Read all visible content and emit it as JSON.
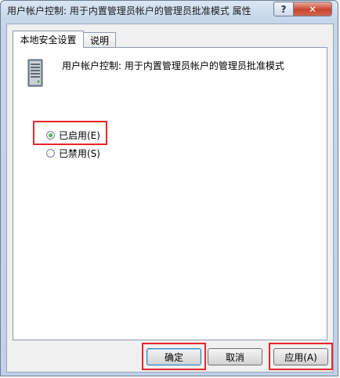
{
  "window": {
    "title": "用户帐户控制: 用于内置管理员帐户的管理员批准模式 属性",
    "help_glyph": "?",
    "close_glyph": "✕"
  },
  "tabs": [
    {
      "label": "本地安全设置",
      "active": true
    },
    {
      "label": "说明",
      "active": false
    }
  ],
  "policy": {
    "icon": "server-icon",
    "name": "用户帐户控制: 用于内置管理员帐户的管理员批准模式"
  },
  "options": [
    {
      "label": "已启用(E)",
      "selected": true
    },
    {
      "label": "已禁用(S)",
      "selected": false
    }
  ],
  "buttons": {
    "ok": "确定",
    "cancel": "取消",
    "apply": "应用(A)"
  },
  "highlight_color": "#e8252b"
}
